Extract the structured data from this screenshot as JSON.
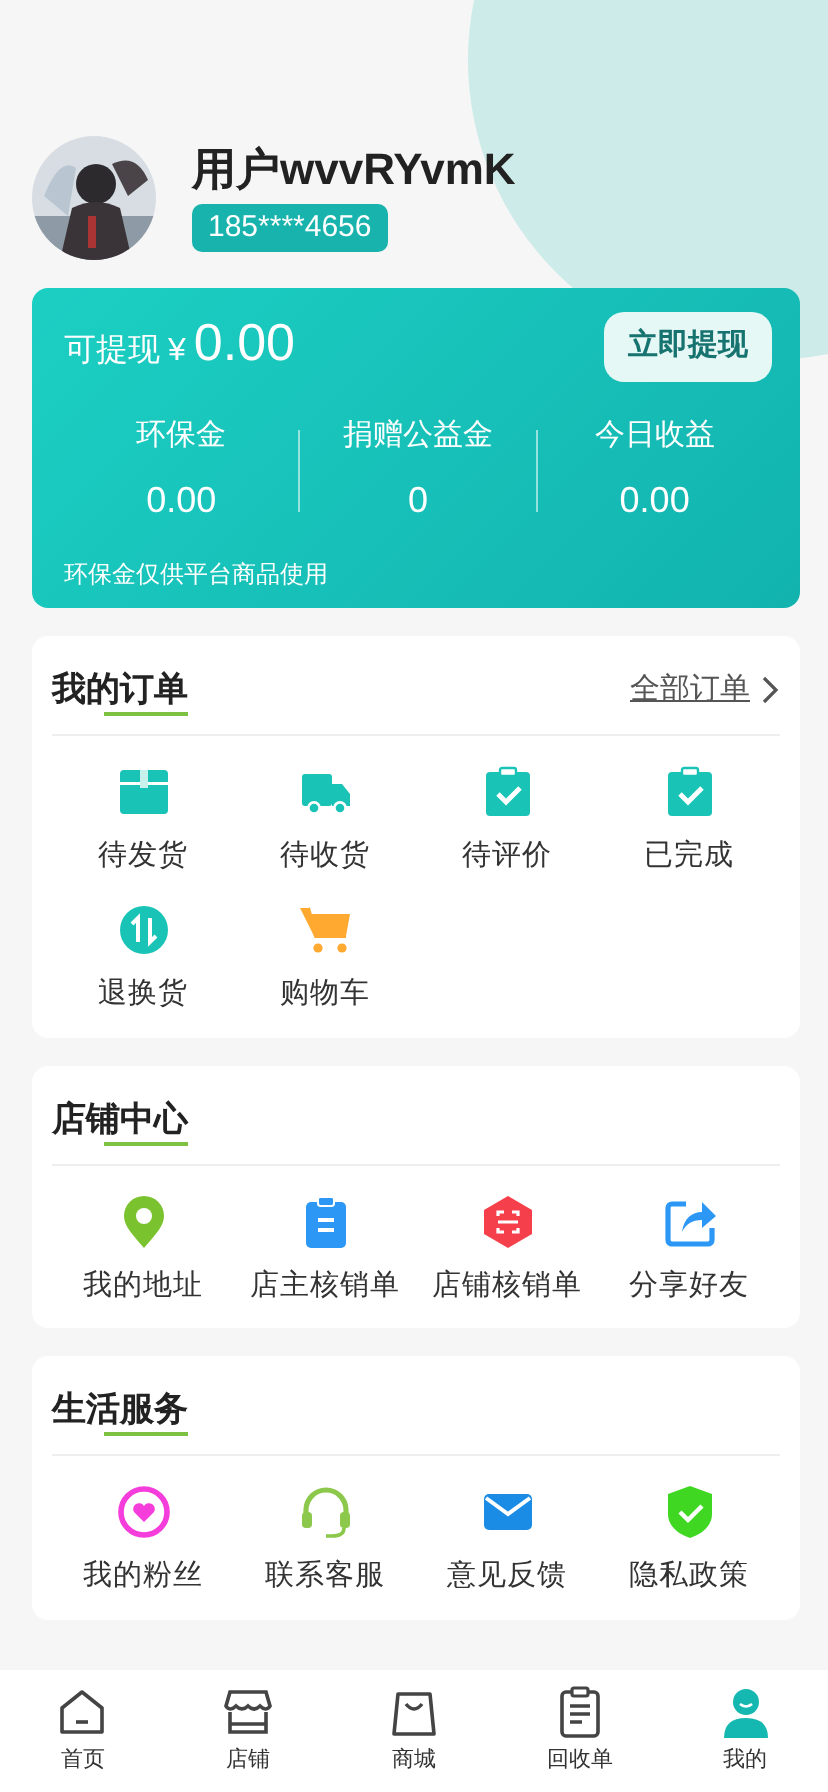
{
  "profile": {
    "name": "用户wvvRYvmK",
    "phone": "185****4656"
  },
  "wallet": {
    "label": "可提现",
    "currency": "¥",
    "amount": "0.00",
    "button": "立即提现",
    "stats": [
      {
        "label": "环保金",
        "value": "0.00"
      },
      {
        "label": "捐赠公益金",
        "value": "0"
      },
      {
        "label": "今日收益",
        "value": "0.00"
      }
    ],
    "note": "环保金仅供平台商品使用"
  },
  "sections": [
    {
      "title": "我的订单",
      "link": "全部订单",
      "items": [
        "待发货",
        "待收货",
        "待评价",
        "已完成",
        "退换货",
        "购物车"
      ]
    },
    {
      "title": "店铺中心",
      "items": [
        "我的地址",
        "店主核销单",
        "店铺核销单",
        "分享好友"
      ]
    },
    {
      "title": "生活服务",
      "items": [
        "我的粉丝",
        "联系客服",
        "意见反馈",
        "隐私政策"
      ]
    }
  ],
  "tabbar": [
    {
      "label": "首页",
      "selected": false
    },
    {
      "label": "店铺",
      "selected": false
    },
    {
      "label": "商城",
      "selected": false
    },
    {
      "label": "回收单",
      "selected": false
    },
    {
      "label": "我的",
      "selected": true
    }
  ]
}
